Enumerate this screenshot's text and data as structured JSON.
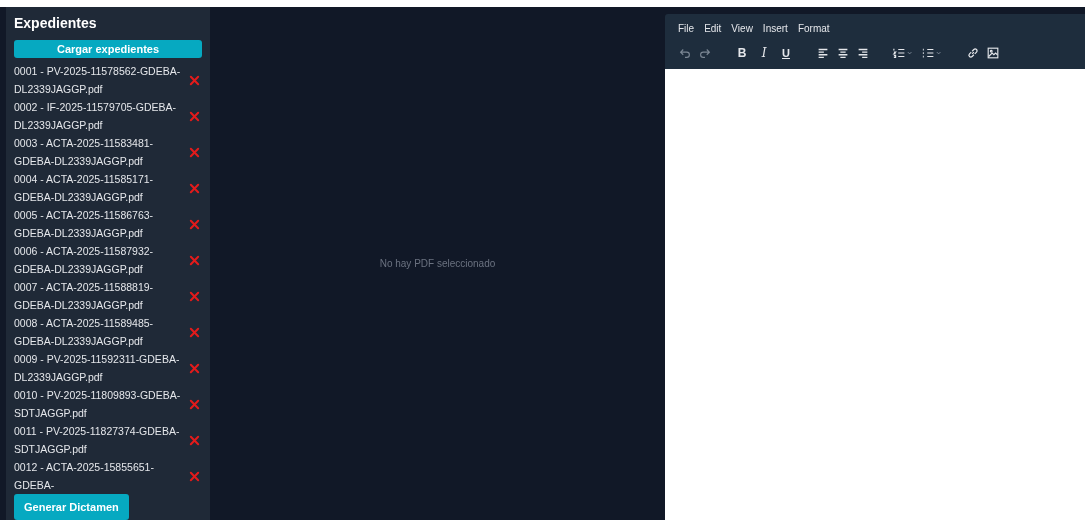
{
  "sidebar": {
    "title": "Expedientes",
    "load_button": "Cargar expedientes",
    "files": [
      {
        "name": "0001 - PV-2025-11578562-GDEBA-DL2339JAGGP.pdf"
      },
      {
        "name": "0002 - IF-2025-11579705-GDEBA-DL2339JAGGP.pdf"
      },
      {
        "name": "0003 - ACTA-2025-11583481-GDEBA-DL2339JAGGP.pdf"
      },
      {
        "name": "0004 - ACTA-2025-11585171-GDEBA-DL2339JAGGP.pdf"
      },
      {
        "name": "0005 - ACTA-2025-11586763-GDEBA-DL2339JAGGP.pdf"
      },
      {
        "name": "0006 - ACTA-2025-11587932-GDEBA-DL2339JAGGP.pdf"
      },
      {
        "name": "0007 - ACTA-2025-11588819-GDEBA-DL2339JAGGP.pdf"
      },
      {
        "name": "0008 - ACTA-2025-11589485-GDEBA-DL2339JAGGP.pdf"
      },
      {
        "name": "0009 - PV-2025-11592311-GDEBA-DL2339JAGGP.pdf"
      },
      {
        "name": "0010 - PV-2025-11809893-GDEBA-SDTJAGGP.pdf"
      },
      {
        "name": "0011 - PV-2025-11827374-GDEBA-SDTJAGGP.pdf"
      },
      {
        "name": "0012 - ACTA-2025-15855651-GDEBA-"
      }
    ],
    "generate_button": "Generar Dictamen"
  },
  "viewer": {
    "empty_message": "No hay PDF seleccionado"
  },
  "editor": {
    "menu": [
      "File",
      "Edit",
      "View",
      "Insert",
      "Format"
    ],
    "toolbar": [
      {
        "kind": "undo",
        "disabled": true
      },
      {
        "kind": "redo",
        "disabled": true
      },
      {
        "kind": "sep"
      },
      {
        "kind": "bold",
        "label": "B"
      },
      {
        "kind": "italic",
        "label": "I"
      },
      {
        "kind": "underline",
        "label": "U"
      },
      {
        "kind": "sep"
      },
      {
        "kind": "align-left"
      },
      {
        "kind": "align-center"
      },
      {
        "kind": "align-right"
      },
      {
        "kind": "sep"
      },
      {
        "kind": "numbered-list"
      },
      {
        "kind": "bullet-list"
      },
      {
        "kind": "sep"
      },
      {
        "kind": "link"
      },
      {
        "kind": "image"
      }
    ]
  }
}
